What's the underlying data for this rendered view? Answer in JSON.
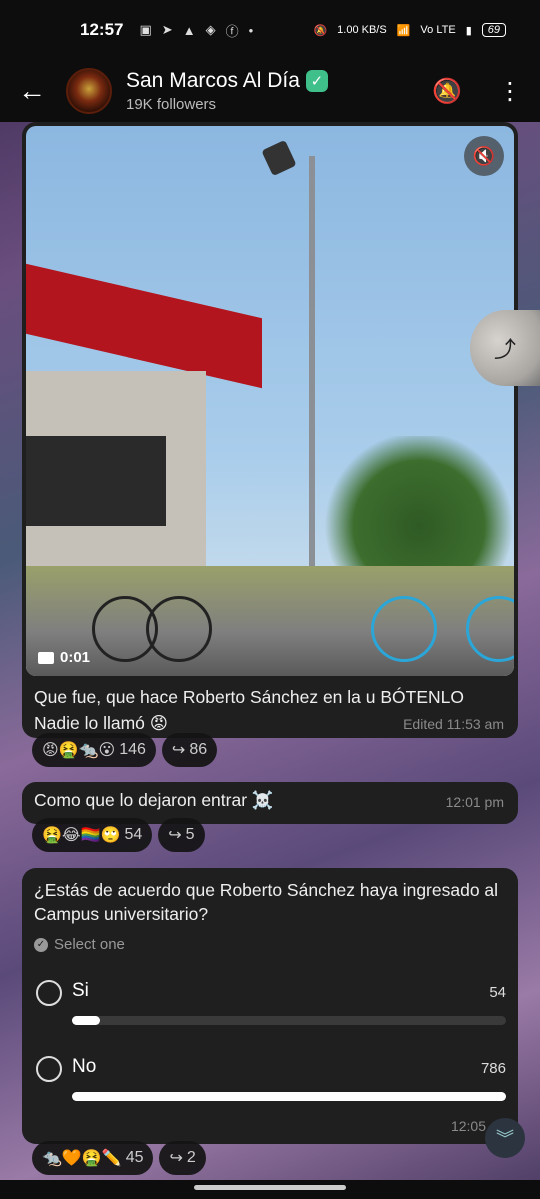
{
  "status": {
    "time": "12:57",
    "net_speed": "1.00 KB/S",
    "network": "Vo LTE",
    "battery": "69"
  },
  "channel": {
    "name": "San Marcos Al Día",
    "followers": "19K followers"
  },
  "video_msg": {
    "duration": "0:01",
    "caption": "Que fue, que hace Roberto Sánchez en la u BÓTENLO Nadie lo llamó 😡",
    "meta": "Edited 11:53 am",
    "reactions": "😡🤮🐀😮",
    "reaction_count": "146",
    "forwards": "86"
  },
  "text_msg": {
    "text": "Como que lo dejaron entrar ☠️",
    "time": "12:01 pm",
    "reactions": "🤮😂🏳️‍🌈🙄",
    "reaction_count": "54",
    "forwards": "5"
  },
  "poll": {
    "question": "¿Estás de acuerdo que Roberto Sánchez haya ingresado al Campus universitario?",
    "subtitle": "Select one",
    "options": [
      {
        "label": "Si",
        "count": "54",
        "fraction": 0.064
      },
      {
        "label": "No",
        "count": "786",
        "fraction": 1.0
      }
    ],
    "time": "12:05",
    "reactions": "🐀🧡🤮✏️",
    "reaction_count": "45",
    "forwards": "2"
  },
  "icons": {
    "back": "arrow-left-icon",
    "mute": "bell-off-icon",
    "menu": "more-vert-icon",
    "sound": "volume-off-icon",
    "camera": "video-camera-icon",
    "forward": "forward-icon",
    "scroll": "chevron-double-down-icon"
  }
}
